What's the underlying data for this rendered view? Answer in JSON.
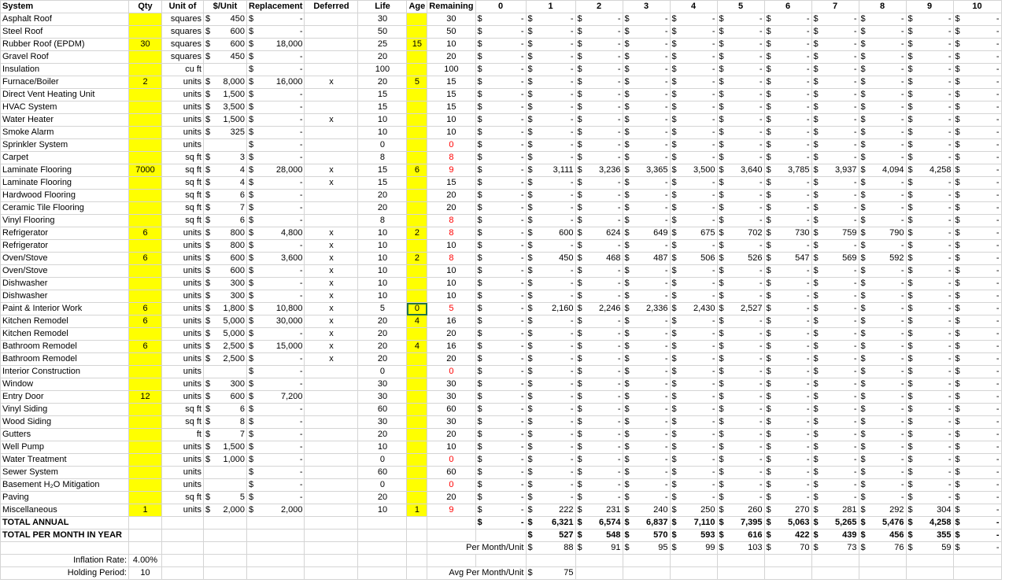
{
  "headers": [
    "System",
    "Qty",
    "Unit of",
    "$/Unit",
    "Replacement",
    "Deferred",
    "Life",
    "Age",
    "Remaining",
    "0",
    "1",
    "2",
    "3",
    "4",
    "5",
    "6",
    "7",
    "8",
    "9",
    "10"
  ],
  "rows": [
    {
      "system": "Asphalt Roof",
      "qty": "",
      "unit": "squares",
      "price": "450",
      "repl": "-",
      "def": "",
      "life": "30",
      "age": "",
      "rem": "30",
      "remRed": false,
      "years": [
        "-",
        "-",
        "-",
        "-",
        "-",
        "-",
        "-",
        "-",
        "-",
        "-",
        "-"
      ]
    },
    {
      "system": "Steel Roof",
      "qty": "",
      "unit": "squares",
      "price": "600",
      "repl": "-",
      "def": "",
      "life": "50",
      "age": "",
      "rem": "50",
      "remRed": false,
      "years": [
        "-",
        "-",
        "-",
        "-",
        "-",
        "-",
        "-",
        "-",
        "-",
        "-",
        "-"
      ]
    },
    {
      "system": "Rubber Roof (EPDM)",
      "qty": "30",
      "unit": "squares",
      "price": "600",
      "repl": "18,000",
      "def": "",
      "life": "25",
      "age": "15",
      "rem": "10",
      "remRed": false,
      "years": [
        "-",
        "-",
        "-",
        "-",
        "-",
        "-",
        "-",
        "-",
        "-",
        "-",
        "-"
      ]
    },
    {
      "system": "Gravel Roof",
      "qty": "",
      "unit": "squares",
      "price": "450",
      "repl": "-",
      "def": "",
      "life": "20",
      "age": "",
      "rem": "20",
      "remRed": false,
      "years": [
        "-",
        "-",
        "-",
        "-",
        "-",
        "-",
        "-",
        "-",
        "-",
        "-",
        "-"
      ]
    },
    {
      "system": "Insulation",
      "qty": "",
      "unit": "cu ft",
      "price": "",
      "repl": "-",
      "def": "",
      "life": "100",
      "age": "",
      "rem": "100",
      "remRed": false,
      "years": [
        "-",
        "-",
        "-",
        "-",
        "-",
        "-",
        "-",
        "-",
        "-",
        "-",
        "-"
      ]
    },
    {
      "system": "Furnace/Boiler",
      "qty": "2",
      "unit": "units",
      "price": "8,000",
      "repl": "16,000",
      "def": "x",
      "life": "20",
      "age": "5",
      "rem": "15",
      "remRed": false,
      "years": [
        "-",
        "-",
        "-",
        "-",
        "-",
        "-",
        "-",
        "-",
        "-",
        "-",
        "-"
      ]
    },
    {
      "system": "Direct Vent Heating Unit",
      "qty": "",
      "unit": "units",
      "price": "1,500",
      "repl": "-",
      "def": "",
      "life": "15",
      "age": "",
      "rem": "15",
      "remRed": false,
      "years": [
        "-",
        "-",
        "-",
        "-",
        "-",
        "-",
        "-",
        "-",
        "-",
        "-",
        "-"
      ]
    },
    {
      "system": "HVAC System",
      "qty": "",
      "unit": "units",
      "price": "3,500",
      "repl": "-",
      "def": "",
      "life": "15",
      "age": "",
      "rem": "15",
      "remRed": false,
      "years": [
        "-",
        "-",
        "-",
        "-",
        "-",
        "-",
        "-",
        "-",
        "-",
        "-",
        "-"
      ]
    },
    {
      "system": "Water Heater",
      "qty": "",
      "unit": "units",
      "price": "1,500",
      "repl": "-",
      "def": "x",
      "life": "10",
      "age": "",
      "rem": "10",
      "remRed": false,
      "years": [
        "-",
        "-",
        "-",
        "-",
        "-",
        "-",
        "-",
        "-",
        "-",
        "-",
        "-"
      ]
    },
    {
      "system": "Smoke Alarm",
      "qty": "",
      "unit": "units",
      "price": "325",
      "repl": "-",
      "def": "",
      "life": "10",
      "age": "",
      "rem": "10",
      "remRed": false,
      "years": [
        "-",
        "-",
        "-",
        "-",
        "-",
        "-",
        "-",
        "-",
        "-",
        "-",
        "-"
      ]
    },
    {
      "system": "Sprinkler System",
      "qty": "",
      "unit": "units",
      "price": "",
      "repl": "-",
      "def": "",
      "life": "0",
      "age": "",
      "rem": "0",
      "remRed": true,
      "years": [
        "-",
        "-",
        "-",
        "-",
        "-",
        "-",
        "-",
        "-",
        "-",
        "-",
        "-"
      ]
    },
    {
      "system": "Carpet",
      "qty": "",
      "unit": "sq ft",
      "price": "3",
      "repl": "-",
      "def": "",
      "life": "8",
      "age": "",
      "rem": "8",
      "remRed": true,
      "years": [
        "-",
        "-",
        "-",
        "-",
        "-",
        "-",
        "-",
        "-",
        "-",
        "-",
        "-"
      ]
    },
    {
      "system": "Laminate Flooring",
      "qty": "7000",
      "unit": "sq ft",
      "price": "4",
      "repl": "28,000",
      "def": "x",
      "life": "15",
      "age": "6",
      "rem": "9",
      "remRed": true,
      "years": [
        "-",
        "3,111",
        "3,236",
        "3,365",
        "3,500",
        "3,640",
        "3,785",
        "3,937",
        "4,094",
        "4,258",
        "-"
      ]
    },
    {
      "system": "Laminate Flooring",
      "qty": "",
      "unit": "sq ft",
      "price": "4",
      "repl": "-",
      "def": "x",
      "life": "15",
      "age": "",
      "rem": "15",
      "remRed": false,
      "years": [
        "-",
        "-",
        "-",
        "-",
        "-",
        "-",
        "-",
        "-",
        "-",
        "-",
        "-"
      ]
    },
    {
      "system": "Hardwood Flooring",
      "qty": "",
      "unit": "sq ft",
      "price": "6",
      "repl": "-",
      "def": "",
      "life": "20",
      "age": "",
      "rem": "20",
      "remRed": false,
      "years": [
        "-",
        "-",
        "-",
        "-",
        "-",
        "-",
        "-",
        "-",
        "-",
        "-",
        "-"
      ]
    },
    {
      "system": "Ceramic Tile Flooring",
      "qty": "",
      "unit": "sq ft",
      "price": "7",
      "repl": "-",
      "def": "",
      "life": "20",
      "age": "",
      "rem": "20",
      "remRed": false,
      "years": [
        "-",
        "-",
        "-",
        "-",
        "-",
        "-",
        "-",
        "-",
        "-",
        "-",
        "-"
      ]
    },
    {
      "system": "Vinyl Flooring",
      "qty": "",
      "unit": "sq ft",
      "price": "6",
      "repl": "-",
      "def": "",
      "life": "8",
      "age": "",
      "rem": "8",
      "remRed": true,
      "years": [
        "-",
        "-",
        "-",
        "-",
        "-",
        "-",
        "-",
        "-",
        "-",
        "-",
        "-"
      ]
    },
    {
      "system": "Refrigerator",
      "qty": "6",
      "unit": "units",
      "price": "800",
      "repl": "4,800",
      "def": "x",
      "life": "10",
      "age": "2",
      "rem": "8",
      "remRed": true,
      "years": [
        "-",
        "600",
        "624",
        "649",
        "675",
        "702",
        "730",
        "759",
        "790",
        "-",
        "-"
      ]
    },
    {
      "system": "Refrigerator",
      "qty": "",
      "unit": "units",
      "price": "800",
      "repl": "-",
      "def": "x",
      "life": "10",
      "age": "",
      "rem": "10",
      "remRed": false,
      "years": [
        "-",
        "-",
        "-",
        "-",
        "-",
        "-",
        "-",
        "-",
        "-",
        "-",
        "-"
      ]
    },
    {
      "system": "Oven/Stove",
      "qty": "6",
      "unit": "units",
      "price": "600",
      "repl": "3,600",
      "def": "x",
      "life": "10",
      "age": "2",
      "rem": "8",
      "remRed": true,
      "years": [
        "-",
        "450",
        "468",
        "487",
        "506",
        "526",
        "547",
        "569",
        "592",
        "-",
        "-"
      ]
    },
    {
      "system": "Oven/Stove",
      "qty": "",
      "unit": "units",
      "price": "600",
      "repl": "-",
      "def": "x",
      "life": "10",
      "age": "",
      "rem": "10",
      "remRed": false,
      "years": [
        "-",
        "-",
        "-",
        "-",
        "-",
        "-",
        "-",
        "-",
        "-",
        "-",
        "-"
      ]
    },
    {
      "system": "Dishwasher",
      "qty": "",
      "unit": "units",
      "price": "300",
      "repl": "-",
      "def": "x",
      "life": "10",
      "age": "",
      "rem": "10",
      "remRed": false,
      "years": [
        "-",
        "-",
        "-",
        "-",
        "-",
        "-",
        "-",
        "-",
        "-",
        "-",
        "-"
      ]
    },
    {
      "system": "Dishwasher",
      "qty": "",
      "unit": "units",
      "price": "300",
      "repl": "-",
      "def": "x",
      "life": "10",
      "age": "",
      "rem": "10",
      "remRed": false,
      "years": [
        "-",
        "-",
        "-",
        "-",
        "-",
        "-",
        "-",
        "-",
        "-",
        "-",
        "-"
      ]
    },
    {
      "system": "Paint & Interior Work",
      "qty": "6",
      "unit": "units",
      "price": "1,800",
      "repl": "10,800",
      "def": "x",
      "life": "5",
      "age": "0",
      "rem": "5",
      "remRed": true,
      "years": [
        "-",
        "2,160",
        "2,246",
        "2,336",
        "2,430",
        "2,527",
        "-",
        "-",
        "-",
        "-",
        "-"
      ]
    },
    {
      "system": "Kitchen Remodel",
      "qty": "6",
      "unit": "units",
      "price": "5,000",
      "repl": "30,000",
      "def": "x",
      "life": "20",
      "age": "4",
      "rem": "16",
      "remRed": false,
      "years": [
        "-",
        "-",
        "-",
        "-",
        "-",
        "-",
        "-",
        "-",
        "-",
        "-",
        "-"
      ]
    },
    {
      "system": "Kitchen Remodel",
      "qty": "",
      "unit": "units",
      "price": "5,000",
      "repl": "-",
      "def": "x",
      "life": "20",
      "age": "",
      "rem": "20",
      "remRed": false,
      "years": [
        "-",
        "-",
        "-",
        "-",
        "-",
        "-",
        "-",
        "-",
        "-",
        "-",
        "-"
      ]
    },
    {
      "system": "Bathroom Remodel",
      "qty": "6",
      "unit": "units",
      "price": "2,500",
      "repl": "15,000",
      "def": "x",
      "life": "20",
      "age": "4",
      "rem": "16",
      "remRed": false,
      "years": [
        "-",
        "-",
        "-",
        "-",
        "-",
        "-",
        "-",
        "-",
        "-",
        "-",
        "-"
      ]
    },
    {
      "system": "Bathroom Remodel",
      "qty": "",
      "unit": "units",
      "price": "2,500",
      "repl": "-",
      "def": "x",
      "life": "20",
      "age": "",
      "rem": "20",
      "remRed": false,
      "years": [
        "-",
        "-",
        "-",
        "-",
        "-",
        "-",
        "-",
        "-",
        "-",
        "-",
        "-"
      ]
    },
    {
      "system": "Interior Construction",
      "qty": "",
      "unit": "units",
      "price": "",
      "repl": "-",
      "def": "",
      "life": "0",
      "age": "",
      "rem": "0",
      "remRed": true,
      "years": [
        "-",
        "-",
        "-",
        "-",
        "-",
        "-",
        "-",
        "-",
        "-",
        "-",
        "-"
      ]
    },
    {
      "system": "Window",
      "qty": "",
      "unit": "units",
      "price": "300",
      "repl": "-",
      "def": "",
      "life": "30",
      "age": "",
      "rem": "30",
      "remRed": false,
      "years": [
        "-",
        "-",
        "-",
        "-",
        "-",
        "-",
        "-",
        "-",
        "-",
        "-",
        "-"
      ]
    },
    {
      "system": "Entry Door",
      "qty": "12",
      "unit": "units",
      "price": "600",
      "repl": "7,200",
      "def": "",
      "life": "30",
      "age": "",
      "rem": "30",
      "remRed": false,
      "years": [
        "-",
        "-",
        "-",
        "-",
        "-",
        "-",
        "-",
        "-",
        "-",
        "-",
        "-"
      ]
    },
    {
      "system": "Vinyl Siding",
      "qty": "",
      "unit": "sq ft",
      "price": "6",
      "repl": "-",
      "def": "",
      "life": "60",
      "age": "",
      "rem": "60",
      "remRed": false,
      "years": [
        "-",
        "-",
        "-",
        "-",
        "-",
        "-",
        "-",
        "-",
        "-",
        "-",
        "-"
      ]
    },
    {
      "system": "Wood Siding",
      "qty": "",
      "unit": "sq ft",
      "price": "8",
      "repl": "-",
      "def": "",
      "life": "30",
      "age": "",
      "rem": "30",
      "remRed": false,
      "years": [
        "-",
        "-",
        "-",
        "-",
        "-",
        "-",
        "-",
        "-",
        "-",
        "-",
        "-"
      ]
    },
    {
      "system": "Gutters",
      "qty": "",
      "unit": "ft",
      "price": "7",
      "repl": "-",
      "def": "",
      "life": "20",
      "age": "",
      "rem": "20",
      "remRed": false,
      "years": [
        "-",
        "-",
        "-",
        "-",
        "-",
        "-",
        "-",
        "-",
        "-",
        "-",
        "-"
      ]
    },
    {
      "system": "Well Pump",
      "qty": "",
      "unit": "units",
      "price": "1,500",
      "repl": "-",
      "def": "",
      "life": "10",
      "age": "",
      "rem": "10",
      "remRed": false,
      "years": [
        "-",
        "-",
        "-",
        "-",
        "-",
        "-",
        "-",
        "-",
        "-",
        "-",
        "-"
      ]
    },
    {
      "system": "Water Treatment",
      "qty": "",
      "unit": "units",
      "price": "1,000",
      "repl": "-",
      "def": "",
      "life": "0",
      "age": "",
      "rem": "0",
      "remRed": true,
      "years": [
        "-",
        "-",
        "-",
        "-",
        "-",
        "-",
        "-",
        "-",
        "-",
        "-",
        "-"
      ]
    },
    {
      "system": "Sewer System",
      "qty": "",
      "unit": "units",
      "price": "",
      "repl": "-",
      "def": "",
      "life": "60",
      "age": "",
      "rem": "60",
      "remRed": false,
      "years": [
        "-",
        "-",
        "-",
        "-",
        "-",
        "-",
        "-",
        "-",
        "-",
        "-",
        "-"
      ]
    },
    {
      "system": "Basement H₂O Mitigation",
      "qty": "",
      "unit": "units",
      "price": "",
      "repl": "-",
      "def": "",
      "life": "0",
      "age": "",
      "rem": "0",
      "remRed": true,
      "years": [
        "-",
        "-",
        "-",
        "-",
        "-",
        "-",
        "-",
        "-",
        "-",
        "-",
        "-"
      ]
    },
    {
      "system": "Paving",
      "qty": "",
      "unit": "sq ft",
      "price": "5",
      "repl": "-",
      "def": "",
      "life": "20",
      "age": "",
      "rem": "20",
      "remRed": false,
      "years": [
        "-",
        "-",
        "-",
        "-",
        "-",
        "-",
        "-",
        "-",
        "-",
        "-",
        "-"
      ]
    },
    {
      "system": "Miscellaneous",
      "qty": "1",
      "unit": "units",
      "price": "2,000",
      "repl": "2,000",
      "def": "",
      "life": "10",
      "age": "1",
      "rem": "9",
      "remRed": true,
      "years": [
        "-",
        "222",
        "231",
        "240",
        "250",
        "260",
        "270",
        "281",
        "292",
        "304",
        "-"
      ]
    }
  ],
  "total_annual": {
    "label": "TOTAL ANNUAL",
    "years": [
      "-",
      "6,321",
      "6,574",
      "6,837",
      "7,110",
      "7,395",
      "5,063",
      "5,265",
      "5,476",
      "4,258",
      "-"
    ]
  },
  "total_month": {
    "label": "TOTAL PER MONTH IN YEAR",
    "years": [
      "",
      "527",
      "548",
      "570",
      "593",
      "616",
      "422",
      "439",
      "456",
      "355",
      "-"
    ]
  },
  "per_month_unit": {
    "label": "Per Month/Unit",
    "years": [
      "",
      "88",
      "91",
      "95",
      "99",
      "103",
      "70",
      "73",
      "76",
      "59",
      "-"
    ]
  },
  "inflation": {
    "label": "Inflation Rate:",
    "value": "4.00%"
  },
  "holding": {
    "label": "Holding Period:",
    "value": "10"
  },
  "avg_per_month": {
    "label": "Avg Per Month/Unit",
    "value": "75"
  },
  "currency_symbol": "$",
  "colors": {
    "highlight": "#ffff00",
    "red": "#ff0000",
    "select": "#217346"
  }
}
